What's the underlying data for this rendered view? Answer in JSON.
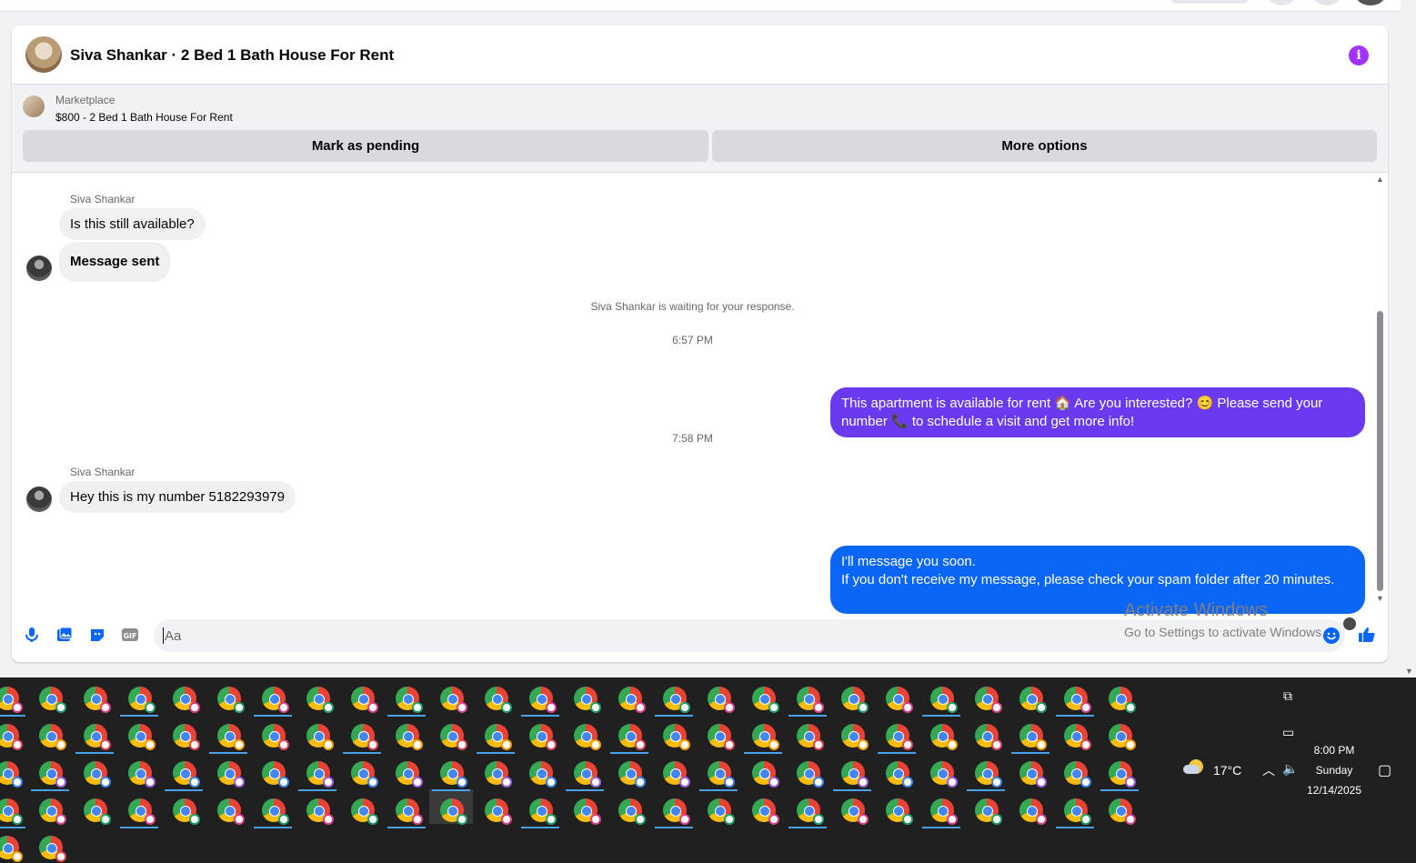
{
  "header": {
    "title": "Siva Shankar · 2 Bed 1 Bath House For Rent",
    "info_icon": "i"
  },
  "listing": {
    "category": "Marketplace",
    "name": "$800 - 2 Bed 1 Bath House For Rent",
    "mark_pending": "Mark as pending",
    "more_options": "More options"
  },
  "conversation": {
    "sender1": "Siva Shankar",
    "msg1": "Is this still available?",
    "msg2": "Message sent",
    "waiting": "Siva Shankar is waiting for your response.",
    "time1": "6:57 PM",
    "out1": "This apartment is available for rent 🏠 Are you interested? 😊 Please send your number 📞 to schedule a visit and get more info!",
    "time2": "7:58 PM",
    "sender2": "Siva Shankar",
    "msg3": "Hey this is my number 5182293979",
    "out2": "I'll message you soon.\n        If you don't receive my message, please check your spam folder after 20 minutes."
  },
  "composer": {
    "placeholder": "Aa",
    "icons": [
      "microphone-icon",
      "photo-icon",
      "sticker-icon",
      "gif-icon",
      "emoji-icon",
      "thumbs-up-icon"
    ],
    "gif_label": "GIF"
  },
  "watermark": {
    "title": "Activate Windows",
    "subtitle": "Go to Settings to activate Windows."
  },
  "taskbar": {
    "weather": "17°C",
    "time": "8:00 PM",
    "day": "Sunday",
    "date": "12/14/2025"
  },
  "colors": {
    "outgoing_purple": "#6a3af0",
    "outgoing_blue": "#0a66f7",
    "info_purple": "#a033ff",
    "taskbar": "#202020"
  }
}
